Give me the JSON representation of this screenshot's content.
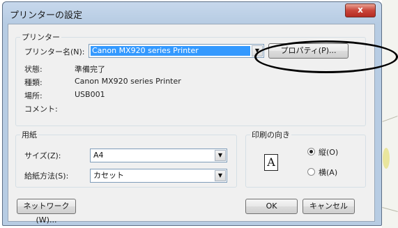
{
  "dialog": {
    "title": "プリンターの設定",
    "close_label": "x"
  },
  "printer_group": {
    "label": "プリンター",
    "name_label": "プリンター名(N):",
    "name_value": "Canon MX920 series Printer",
    "properties_button": "プロパティ(P)...",
    "status_label": "状態:",
    "status_value": "準備完了",
    "type_label": "種類:",
    "type_value": "Canon MX920 series Printer",
    "location_label": "場所:",
    "location_value": "USB001",
    "comment_label": "コメント:",
    "comment_value": ""
  },
  "paper_group": {
    "label": "用紙",
    "size_label": "サイズ(Z):",
    "size_value": "A4",
    "source_label": "給紙方法(S):",
    "source_value": "カセット"
  },
  "orientation_group": {
    "label": "印刷の向き",
    "icon_letter": "A",
    "portrait_label": "縦(O)",
    "landscape_label": "横(A)",
    "selected": "portrait"
  },
  "footer": {
    "network_button": "ネットワーク(W)...",
    "ok_button": "OK",
    "cancel_button": "キャンセル"
  },
  "annotation": {
    "color": "#000000"
  }
}
